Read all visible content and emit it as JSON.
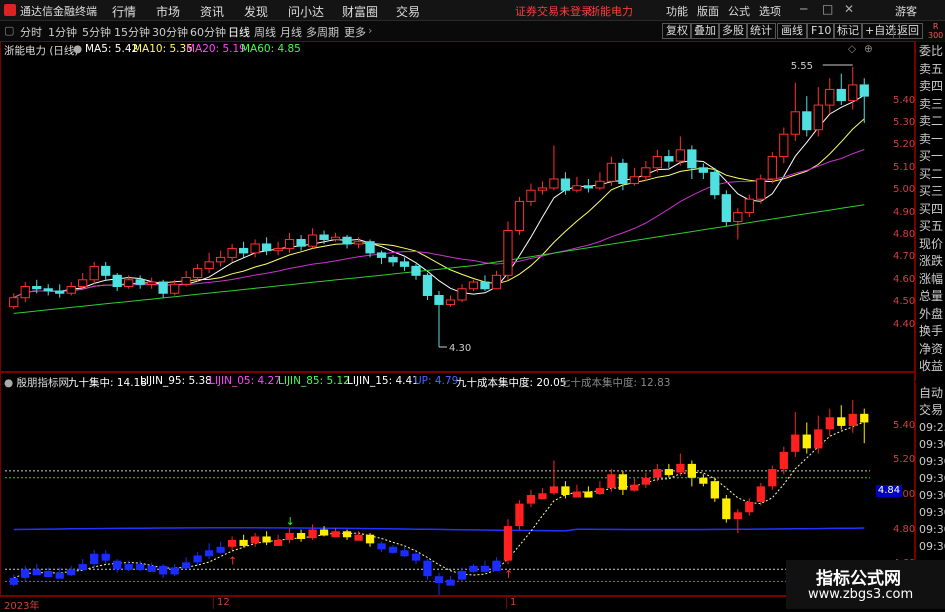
{
  "window": {
    "title": "通达信金融终端",
    "warning": "证券交易未登录",
    "warning_stock": "浙能电力",
    "account": "游客"
  },
  "menus": [
    "行情",
    "市场",
    "资讯",
    "发现",
    "问小达",
    "财富圈",
    "交易"
  ],
  "right_menus": [
    "功能",
    "版面",
    "公式",
    "选项"
  ],
  "periods": [
    "分时",
    "1分钟",
    "5分钟",
    "15分钟",
    "30分钟",
    "60分钟",
    "日线",
    "周线",
    "月线",
    "多周期",
    "更多"
  ],
  "active_period": "日线",
  "right_tools": [
    "复权",
    "叠加",
    "多股",
    "统计",
    "画线",
    "F10",
    "标记",
    "+自选",
    "返回"
  ],
  "badge": {
    "r": "R",
    "n": "300"
  },
  "main": {
    "stock_label": "浙能电力 (日线)",
    "ma": [
      {
        "label": "MA5: 5.42",
        "color": "#ffffff"
      },
      {
        "label": "MA10: 5.35",
        "color": "#ffff66"
      },
      {
        "label": "MA20: 5.19",
        "color": "#ff44ff"
      },
      {
        "label": "MA60: 4.85",
        "color": "#44ff44"
      }
    ],
    "high_label": "5.55",
    "low_label": "4.30",
    "y_ticks": [
      "5.40",
      "5.30",
      "5.20",
      "5.10",
      "5.00",
      "4.90",
      "4.80",
      "4.70",
      "4.60",
      "4.50",
      "4.40"
    ]
  },
  "indicator": {
    "name": "殷朋指标网",
    "items": [
      {
        "label": "九十集中: 14.18",
        "color": "#ffffff"
      },
      {
        "label": "LIJIN_95: 5.38",
        "color": "#ffffff"
      },
      {
        "label": "LIJIN_05: 4.27",
        "color": "#ff44ff"
      },
      {
        "label": "LIJIN_85: 5.12",
        "color": "#44ff44"
      },
      {
        "label": "LIJIN_15: 4.41",
        "color": "#ffffff"
      },
      {
        "label": "UP: 4.79",
        "color": "#4466ff"
      },
      {
        "label": "九十成本集中度: 20.05",
        "color": "#ffffff"
      },
      {
        "label": "七十成本集中度: 12.83",
        "color": "#888888"
      }
    ],
    "y_ticks": [
      "5.40",
      "5.20",
      "5.00",
      "4.80",
      "4.60"
    ],
    "current_tag": "4.84"
  },
  "xaxis": {
    "labels": [
      "2023年",
      "12",
      "1"
    ]
  },
  "sidebar": {
    "items": [
      "委比",
      "卖五",
      "卖四",
      "卖三",
      "卖二",
      "卖一",
      "买一",
      "买二",
      "买三",
      "买四",
      "买五",
      "现价",
      "涨跌",
      "涨幅",
      "总量",
      "外盘",
      "换手",
      "净资",
      "收益"
    ]
  },
  "sidebar2": {
    "items": [
      "自动",
      "交易",
      "09:25",
      "09:30",
      "09:30",
      "09:30",
      "09:30",
      "09:30",
      "09:30",
      "09:30"
    ]
  },
  "watermark": {
    "title": "指标公式网",
    "url": "www.zbgs3.com"
  },
  "chart_data": {
    "type": "candlestick",
    "ylim": [
      4.3,
      5.55
    ],
    "candles": [
      [
        4.48,
        4.52,
        4.54,
        4.47
      ],
      [
        4.52,
        4.57,
        4.59,
        4.5
      ],
      [
        4.57,
        4.56,
        4.6,
        4.54
      ],
      [
        4.56,
        4.55,
        4.58,
        4.53
      ],
      [
        4.55,
        4.54,
        4.58,
        4.52
      ],
      [
        4.54,
        4.57,
        4.59,
        4.53
      ],
      [
        4.57,
        4.6,
        4.63,
        4.56
      ],
      [
        4.6,
        4.66,
        4.68,
        4.58
      ],
      [
        4.66,
        4.62,
        4.68,
        4.6
      ],
      [
        4.62,
        4.57,
        4.63,
        4.55
      ],
      [
        4.57,
        4.6,
        4.62,
        4.56
      ],
      [
        4.6,
        4.58,
        4.62,
        4.56
      ],
      [
        4.58,
        4.59,
        4.61,
        4.56
      ],
      [
        4.59,
        4.54,
        4.6,
        4.52
      ],
      [
        4.54,
        4.58,
        4.6,
        4.53
      ],
      [
        4.58,
        4.61,
        4.64,
        4.57
      ],
      [
        4.61,
        4.65,
        4.67,
        4.59
      ],
      [
        4.65,
        4.68,
        4.72,
        4.63
      ],
      [
        4.68,
        4.7,
        4.73,
        4.66
      ],
      [
        4.7,
        4.74,
        4.76,
        4.68
      ],
      [
        4.74,
        4.72,
        4.77,
        4.7
      ],
      [
        4.72,
        4.76,
        4.78,
        4.7
      ],
      [
        4.76,
        4.73,
        4.79,
        4.71
      ],
      [
        4.73,
        4.74,
        4.77,
        4.71
      ],
      [
        4.74,
        4.78,
        4.81,
        4.72
      ],
      [
        4.78,
        4.75,
        4.8,
        4.73
      ],
      [
        4.75,
        4.8,
        4.83,
        4.74
      ],
      [
        4.8,
        4.78,
        4.82,
        4.76
      ],
      [
        4.78,
        4.79,
        4.81,
        4.77
      ],
      [
        4.79,
        4.76,
        4.8,
        4.74
      ],
      [
        4.76,
        4.77,
        4.79,
        4.74
      ],
      [
        4.77,
        4.72,
        4.78,
        4.7
      ],
      [
        4.72,
        4.7,
        4.73,
        4.67
      ],
      [
        4.7,
        4.68,
        4.71,
        4.66
      ],
      [
        4.68,
        4.66,
        4.7,
        4.64
      ],
      [
        4.66,
        4.62,
        4.67,
        4.6
      ],
      [
        4.62,
        4.53,
        4.63,
        4.51
      ],
      [
        4.53,
        4.49,
        4.55,
        4.3
      ],
      [
        4.49,
        4.51,
        4.53,
        4.48
      ],
      [
        4.51,
        4.56,
        4.58,
        4.5
      ],
      [
        4.56,
        4.59,
        4.6,
        4.55
      ],
      [
        4.59,
        4.56,
        4.62,
        4.55
      ],
      [
        4.56,
        4.62,
        4.64,
        4.56
      ],
      [
        4.62,
        4.82,
        4.86,
        4.6
      ],
      [
        4.82,
        4.95,
        4.97,
        4.8
      ],
      [
        4.95,
        5.0,
        5.03,
        4.93
      ],
      [
        5.0,
        5.01,
        5.04,
        4.98
      ],
      [
        5.01,
        5.05,
        5.2,
        5.0
      ],
      [
        5.05,
        5.0,
        5.08,
        4.98
      ],
      [
        5.0,
        5.02,
        5.06,
        4.99
      ],
      [
        5.02,
        5.01,
        5.05,
        4.99
      ],
      [
        5.01,
        5.04,
        5.08,
        5.0
      ],
      [
        5.04,
        5.12,
        5.15,
        5.02
      ],
      [
        5.12,
        5.03,
        5.14,
        5.0
      ],
      [
        5.03,
        5.06,
        5.1,
        5.02
      ],
      [
        5.06,
        5.1,
        5.13,
        5.04
      ],
      [
        5.1,
        5.15,
        5.18,
        5.08
      ],
      [
        5.15,
        5.13,
        5.18,
        5.1
      ],
      [
        5.13,
        5.18,
        5.24,
        5.11
      ],
      [
        5.18,
        5.1,
        5.2,
        5.05
      ],
      [
        5.1,
        5.08,
        5.12,
        5.05
      ],
      [
        5.08,
        4.98,
        5.1,
        4.96
      ],
      [
        4.98,
        4.86,
        5.0,
        4.84
      ],
      [
        4.86,
        4.9,
        4.92,
        4.78
      ],
      [
        4.9,
        4.96,
        4.98,
        4.88
      ],
      [
        4.96,
        5.05,
        5.07,
        4.94
      ],
      [
        5.05,
        5.15,
        5.17,
        5.03
      ],
      [
        5.15,
        5.25,
        5.28,
        5.12
      ],
      [
        5.25,
        5.35,
        5.48,
        5.22
      ],
      [
        5.35,
        5.27,
        5.42,
        5.24
      ],
      [
        5.27,
        5.38,
        5.46,
        5.24
      ],
      [
        5.38,
        5.45,
        5.5,
        5.34
      ],
      [
        5.45,
        5.4,
        5.52,
        5.38
      ],
      [
        5.4,
        5.47,
        5.55,
        5.36
      ],
      [
        5.47,
        5.42,
        5.5,
        5.3
      ]
    ]
  }
}
